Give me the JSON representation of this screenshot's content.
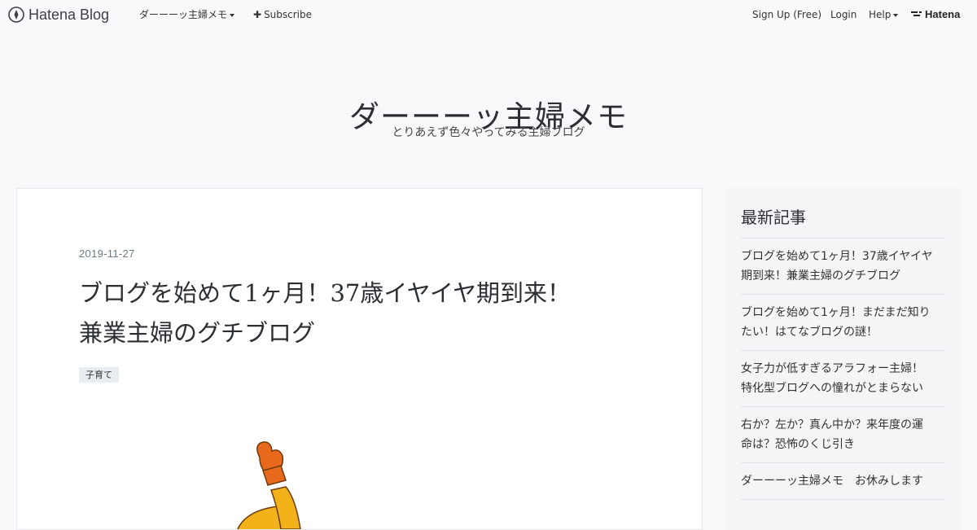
{
  "topbar": {
    "brand": "Hatena Blog",
    "blog_menu": "ダーーーッ主婦メモ",
    "subscribe": "Subscribe",
    "signup": "Sign Up (Free)",
    "login": "Login",
    "help": "Help",
    "hatena": "Hatena"
  },
  "header": {
    "title": "ダーーーッ主婦メモ",
    "description": "とりあえず色々やってみる主婦ブログ"
  },
  "entry": {
    "date": "2019-11-27",
    "title_line1": "ブログを始めて1ヶ月！37歳イヤイヤ期到来！",
    "title_line2": "兼業主婦のグチブログ",
    "category": "子育て"
  },
  "sidebar": {
    "heading": "最新記事",
    "items": [
      {
        "line1": "ブログを始めて1ヶ月！37歳イヤイヤ",
        "line2": "期到来！兼業主婦のグチブログ"
      },
      {
        "line1": "ブログを始めて1ヶ月！まだまだ知り",
        "line2": "たい！はてなブログの謎！"
      },
      {
        "line1": "女子力が低すぎるアラフォー主婦！",
        "line2": "特化型ブログへの憧れがとまらない"
      },
      {
        "line1": "右か？左か？真ん中か？来年度の運",
        "line2": "命は？恐怖のくじ引き"
      },
      {
        "line1": "ダーーーッ主婦メモ　お休みします",
        "line2": ""
      }
    ]
  },
  "colors": {
    "background": "#f8f9fb",
    "card": "#ffffff",
    "illustration_orange": "#e8691c",
    "illustration_yellow": "#f4b21a"
  }
}
